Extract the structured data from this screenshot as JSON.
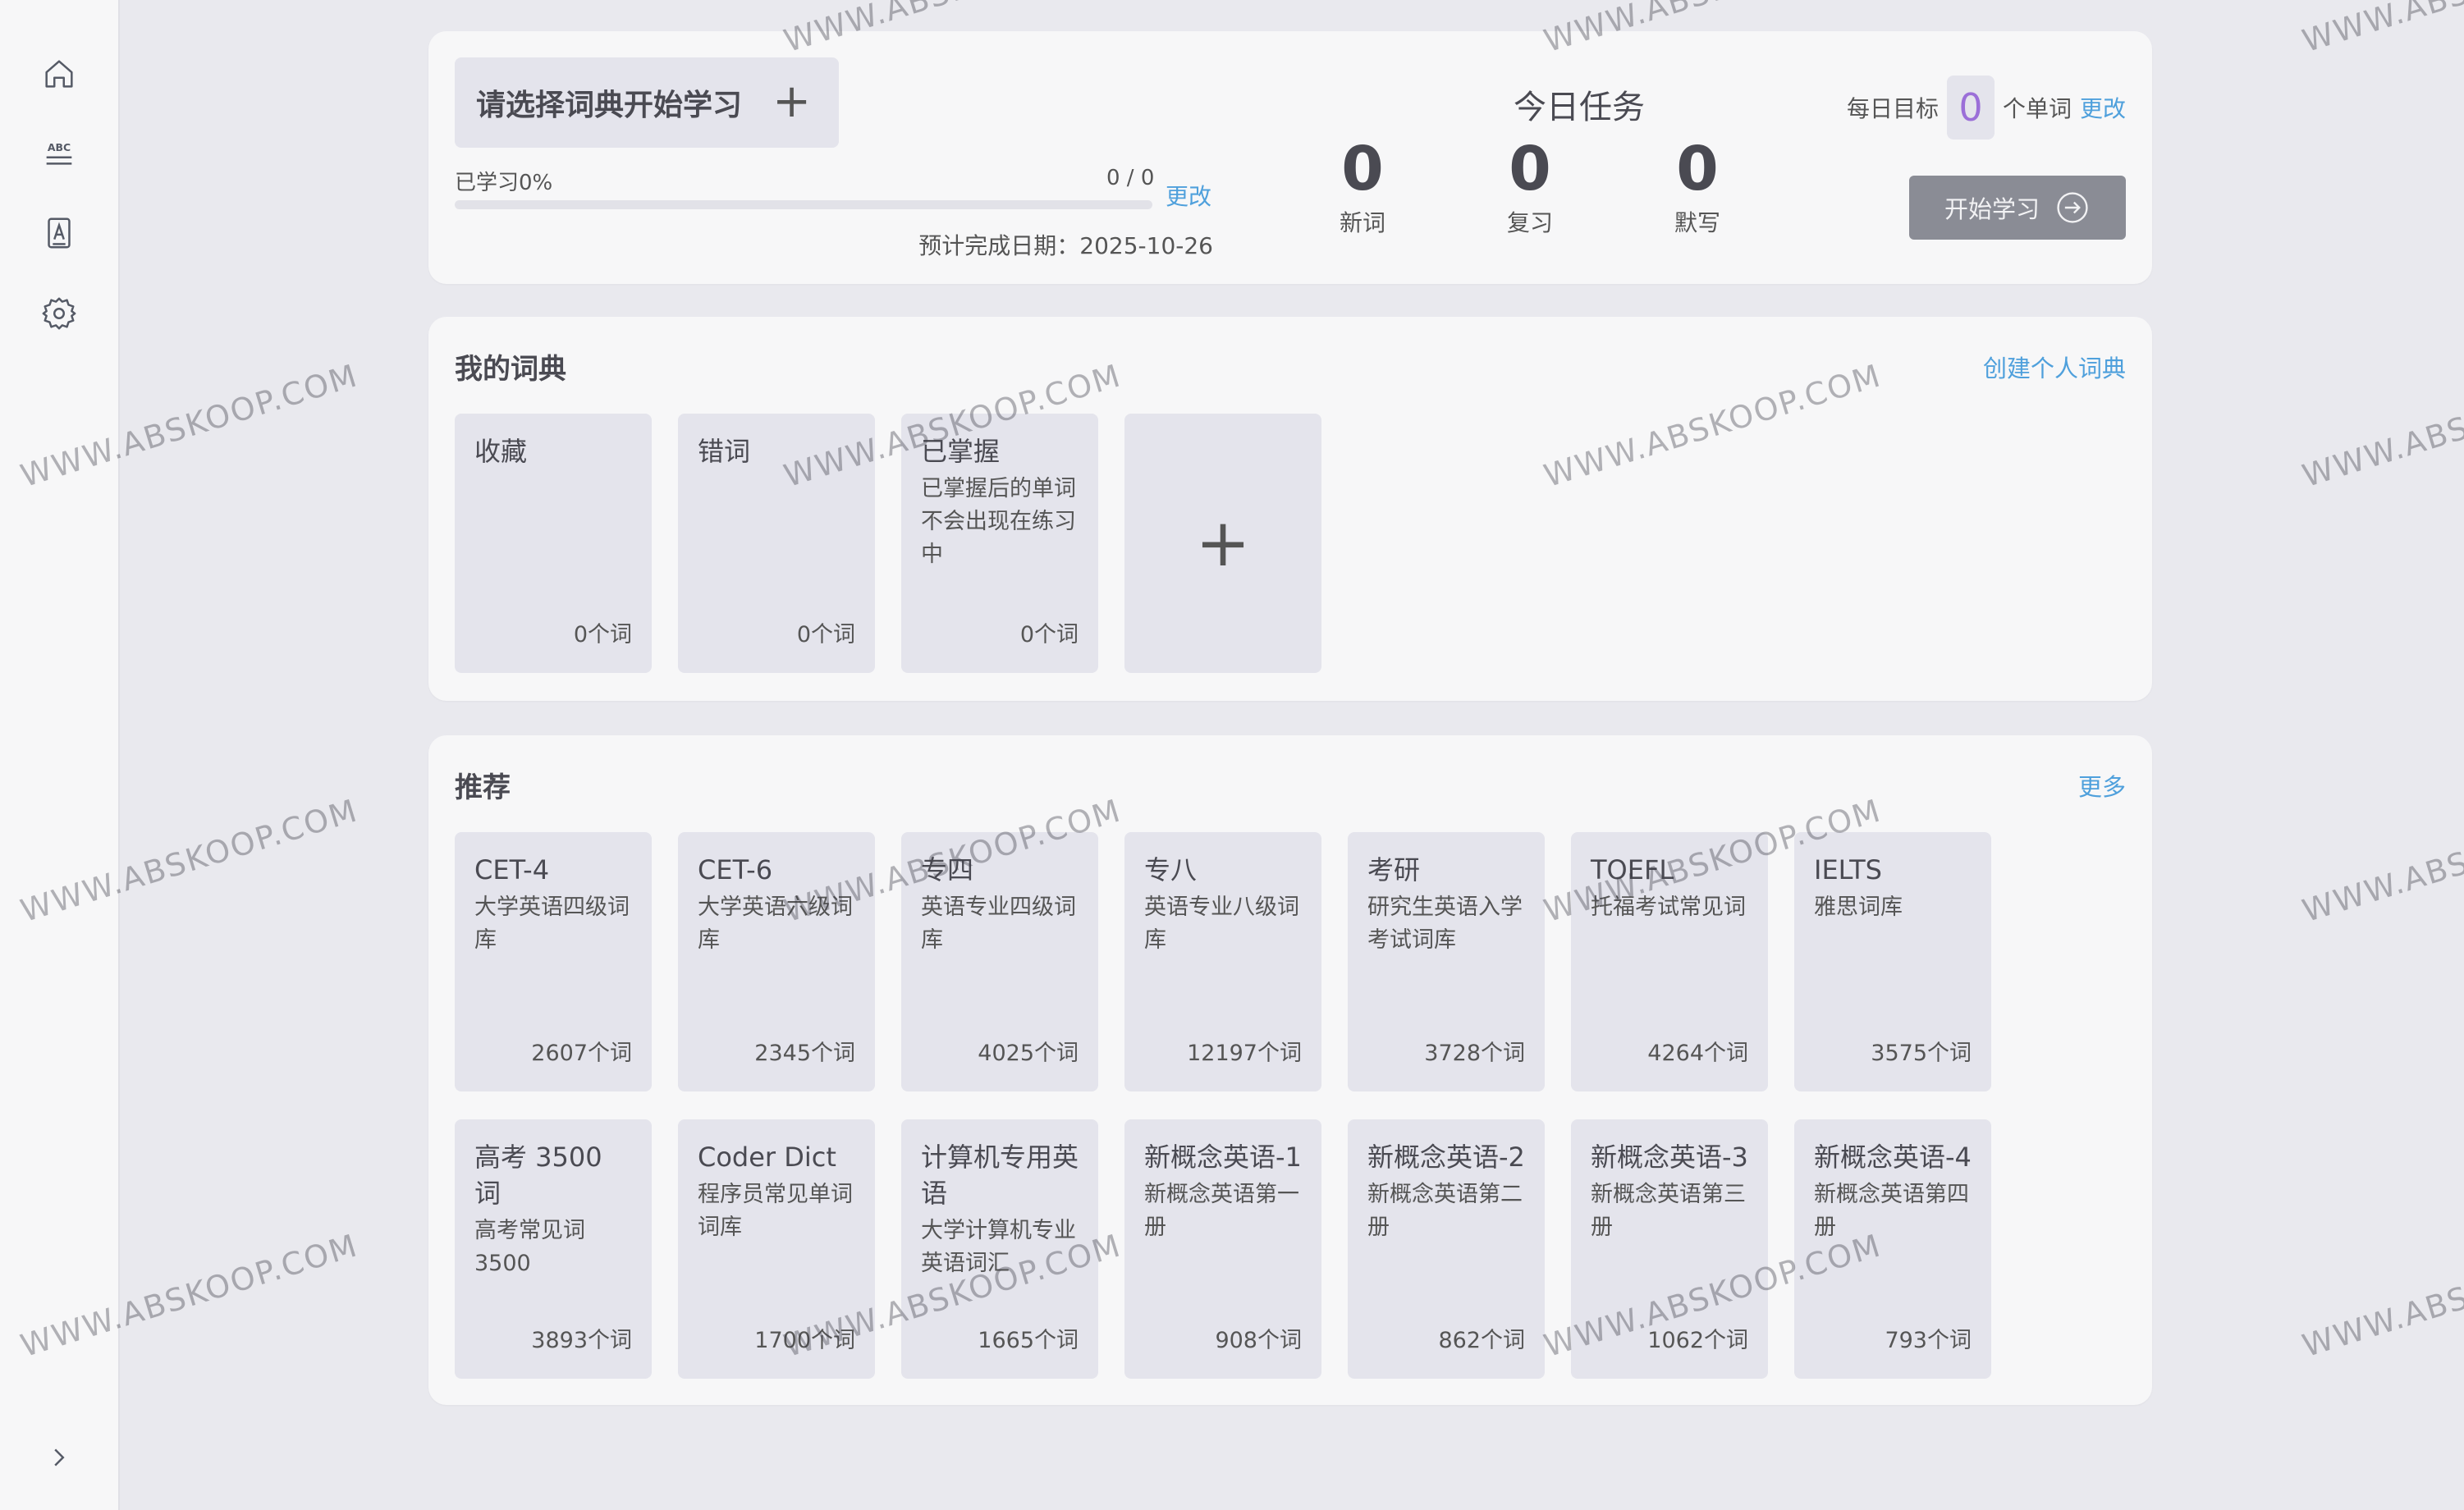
{
  "sidebar": {
    "items": [
      {
        "name": "home",
        "icon": "home-icon"
      },
      {
        "name": "words",
        "icon": "abc-icon"
      },
      {
        "name": "dictionary",
        "icon": "book-icon"
      },
      {
        "name": "settings",
        "icon": "gear-icon"
      }
    ],
    "expand_icon": "chevron-right-icon"
  },
  "task": {
    "select_dict_label": "请选择词典开始学习",
    "add_icon": "+",
    "progress_label": "已学习0%",
    "progress_count": "0 / 0",
    "progress_fraction": 0,
    "change_label": "更改",
    "eta": "预计完成日期：2025-10-26",
    "title": "今日任务",
    "stats": [
      {
        "value": "0",
        "label": "新词"
      },
      {
        "value": "0",
        "label": "复习"
      },
      {
        "value": "0",
        "label": "默写"
      }
    ],
    "goal_prefix": "每日目标",
    "goal_value": "0",
    "goal_suffix": "个单词",
    "goal_change": "更改",
    "start_label": "开始学习"
  },
  "my_dicts": {
    "title": "我的词典",
    "create_link": "创建个人词典",
    "cards": [
      {
        "title": "收藏",
        "desc": "",
        "count": "0个词"
      },
      {
        "title": "错词",
        "desc": "",
        "count": "0个词"
      },
      {
        "title": "已掌握",
        "desc": "已掌握后的单词不会出现在练习中",
        "count": "0个词"
      }
    ],
    "add_icon": "+"
  },
  "recommend": {
    "title": "推荐",
    "more_link": "更多",
    "cards": [
      {
        "title": "CET-4",
        "desc": "大学英语四级词库",
        "count": "2607个词"
      },
      {
        "title": "CET-6",
        "desc": "大学英语六级词库",
        "count": "2345个词"
      },
      {
        "title": "专四",
        "desc": "英语专业四级词库",
        "count": "4025个词"
      },
      {
        "title": "专八",
        "desc": "英语专业八级词库",
        "count": "12197个词"
      },
      {
        "title": "考研",
        "desc": "研究生英语入学考试词库",
        "count": "3728个词"
      },
      {
        "title": "TOEFL",
        "desc": "托福考试常见词",
        "count": "4264个词"
      },
      {
        "title": "IELTS",
        "desc": "雅思词库",
        "count": "3575个词"
      },
      {
        "title": "高考 3500 词",
        "desc": "高考常见词 3500",
        "count": "3893个词"
      },
      {
        "title": "Coder Dict",
        "desc": "程序员常见单词词库",
        "count": "1700个词"
      },
      {
        "title": "计算机专用英语",
        "desc": "大学计算机专业英语词汇",
        "count": "1665个词"
      },
      {
        "title": "新概念英语-1",
        "desc": "新概念英语第一册",
        "count": "908个词"
      },
      {
        "title": "新概念英语-2",
        "desc": "新概念英语第二册",
        "count": "862个词"
      },
      {
        "title": "新概念英语-3",
        "desc": "新概念英语第三册",
        "count": "1062个词"
      },
      {
        "title": "新概念英语-4",
        "desc": "新概念英语第四册",
        "count": "793个词"
      }
    ]
  },
  "watermark": "WWW.ABSKOOP.COM",
  "colors": {
    "accent_link": "#4fa0dc",
    "goal_value": "#9b6fd8",
    "card_bg": "#e4e4ec",
    "start_button": "#8a8c95"
  }
}
